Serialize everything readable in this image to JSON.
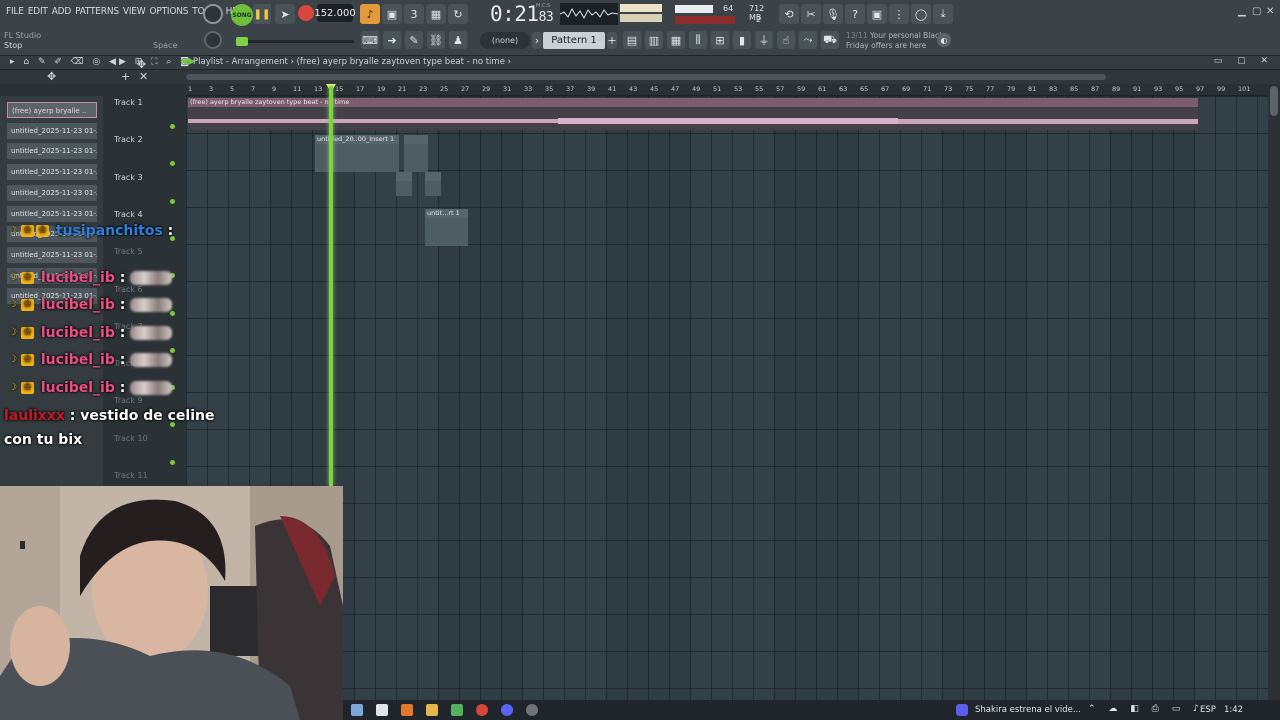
{
  "menu": [
    "FILE",
    "EDIT",
    "ADD",
    "PATTERNS",
    "VIEW",
    "OPTIONS",
    "TOOLS",
    "HELP"
  ],
  "app": {
    "name": "FL Studio",
    "status": "Stop",
    "space_hint": "Space"
  },
  "transport": {
    "song_label": "SONG",
    "tempo": "152.000",
    "time_main": "0:21",
    "time_ms": "83",
    "time_unit": "M:C:S"
  },
  "resources": {
    "cpu": "64",
    "memory": "712 MB",
    "voices": "2"
  },
  "pattern": {
    "selector_none": "(none)",
    "current": "Pattern 1"
  },
  "promo": {
    "date": "13/11",
    "line1": "Your personal Black",
    "line2": "Friday offers are here"
  },
  "playlist": {
    "title": "Playlist - Arrangement › (free) ayerp  bryalle  zaytoven type beat - no time ›",
    "ruler": [
      "1",
      "3",
      "5",
      "7",
      "9",
      "11",
      "13",
      "15",
      "17",
      "19",
      "21",
      "23",
      "25",
      "27",
      "29",
      "31",
      "33",
      "35",
      "37",
      "39",
      "41",
      "43",
      "45",
      "47",
      "49",
      "51",
      "53",
      "55",
      "57",
      "59",
      "61",
      "63",
      "65",
      "67",
      "69",
      "71",
      "73",
      "75",
      "77",
      "79",
      "81",
      "83",
      "85",
      "87",
      "89",
      "91",
      "93",
      "95",
      "97",
      "99",
      "101"
    ]
  },
  "picker": [
    "(free) ayerp  bryalle ..",
    "untitled_2025-11-23 01-..",
    "untitled_2025-11-23 01-..",
    "untitled_2025-11-23 01-..",
    "untitled_2025-11-23 01-..",
    "untitled_2025-11-23 01-..",
    "untitled_2025-11-23 01-..",
    "untitled_2025-11-23 01-..",
    "untitled_2025-11-23 01-..",
    "untitled_2025-11-23 01-.."
  ],
  "tracks": [
    "Track 1",
    "Track 2",
    "Track 3",
    "Track 4",
    "Track 5",
    "Track 6",
    "Track 7",
    "Track 8",
    "Track 9",
    "Track 10",
    "Track 11"
  ],
  "clips": {
    "audio": "(free) ayerp  bryalle  zaytoven type beat - no time",
    "insert": "untitled_20..00_Insert 1",
    "short": "untit...rt 1"
  },
  "chat": [
    {
      "user": "tusipanchitos",
      "msg": ""
    },
    {
      "user": "lucibel_ib",
      "msg": ""
    },
    {
      "user": "lucibel_ib",
      "msg": ""
    },
    {
      "user": "lucibel_ib",
      "msg": ""
    },
    {
      "user": "lucibel_ib",
      "msg": ""
    },
    {
      "user": "lucibel_ib",
      "msg": ""
    },
    {
      "user": "laulixxx",
      "msg": "vestido de celine",
      "msg2": "con tu bix"
    }
  ],
  "taskbar": {
    "news": "Shakira estrena el vide...",
    "lang": "ESP",
    "time": "1:42"
  },
  "colors": {
    "accent_green": "#7fd14a",
    "record_red": "#d9463d",
    "clip_pink": "#7b5d6e",
    "chat_pink": "#ef4d86",
    "chat_blue": "#2d7fe0"
  }
}
